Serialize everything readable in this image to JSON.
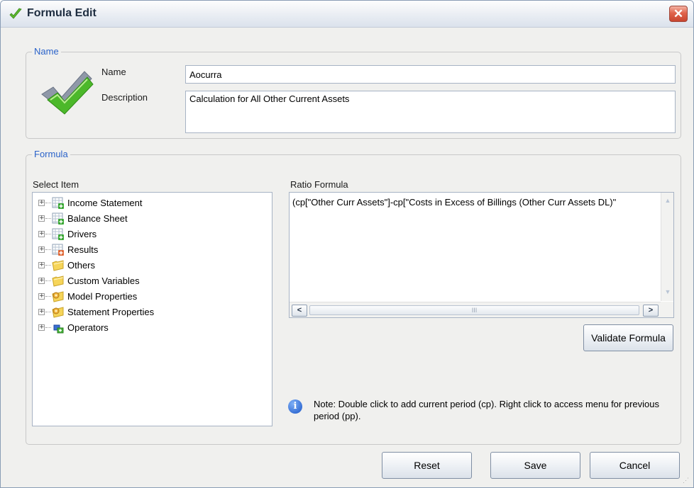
{
  "window": {
    "title": "Formula Edit",
    "close_glyph": "✕",
    "title_icon": "checkmark-icon"
  },
  "name_group": {
    "legend": "Name",
    "name_label": "Name",
    "name_value": "Aocurra",
    "description_label": "Description",
    "description_value": "Calculation for All Other Current Assets",
    "icon": "big-checkmark-icon"
  },
  "formula_group": {
    "legend": "Formula",
    "select_item_label": "Select Item",
    "tree_items": [
      {
        "label": "Income Statement",
        "icon": "grid-icon"
      },
      {
        "label": "Balance Sheet",
        "icon": "grid-icon"
      },
      {
        "label": "Drivers",
        "icon": "grid-icon"
      },
      {
        "label": "Results",
        "icon": "grid-icon"
      },
      {
        "label": "Others",
        "icon": "folder-icon"
      },
      {
        "label": "Custom Variables",
        "icon": "folder-icon"
      },
      {
        "label": "Model Properties",
        "icon": "folder-gear-icon"
      },
      {
        "label": "Statement Properties",
        "icon": "folder-gear-icon"
      },
      {
        "label": "Operators",
        "icon": "operators-icon"
      }
    ],
    "ratio_formula_label": "Ratio Formula",
    "ratio_formula_value": "(cp[\"Other Curr Assets\"]-cp[\"Costs in Excess of Billings (Other Curr Assets DL)\"",
    "validate_button": "Validate Formula",
    "note_text": "Note: Double click to add current period (cp). Right click to access menu for previous period (pp).",
    "note_icon_glyph": "i"
  },
  "footer": {
    "reset_button": "Reset",
    "save_button": "Save",
    "cancel_button": "Cancel"
  },
  "colors": {
    "legend_blue": "#2a62c9",
    "close_red": "#d9553d",
    "check_green": "#5cb82e"
  }
}
